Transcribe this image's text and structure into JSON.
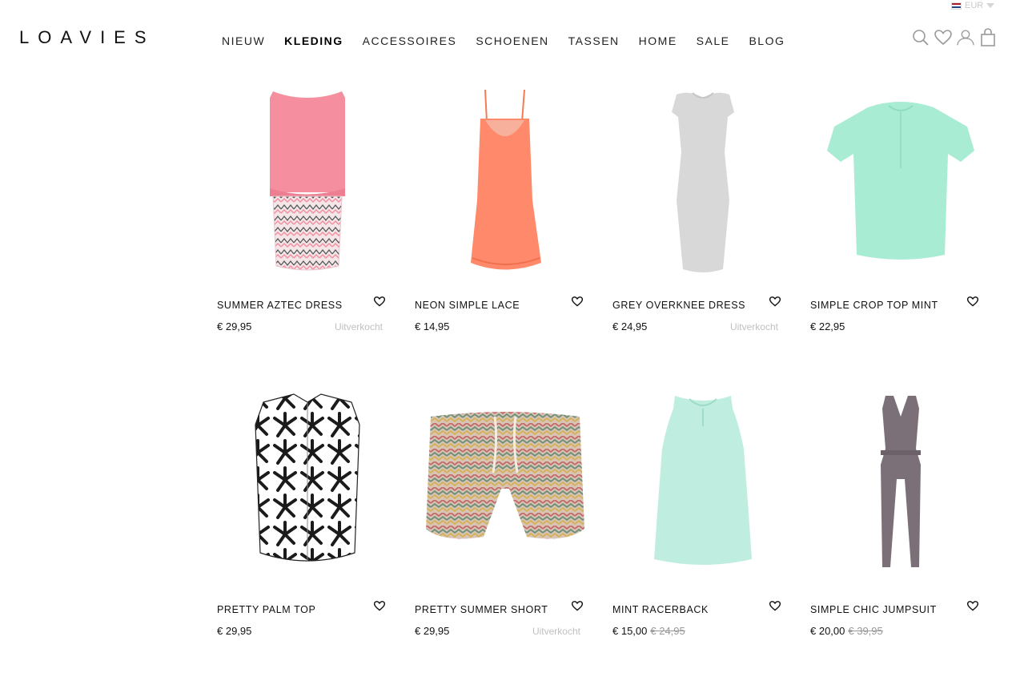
{
  "header": {
    "logo": "LOAVIES",
    "currency": "EUR",
    "nav": [
      "NIEUW",
      "KLEDING",
      "ACCESSOIRES",
      "SCHOENEN",
      "TASSEN",
      "HOME",
      "SALE",
      "BLOG"
    ],
    "active_nav": "KLEDING",
    "icons": [
      "search-icon",
      "wishlist-heart-icon",
      "account-icon",
      "cart-bag-icon"
    ]
  },
  "products": [
    {
      "name": "SUMMER AZTEC DRESS",
      "price": "€ 29,95",
      "old_price": "",
      "status": "Uitverkocht"
    },
    {
      "name": "NEON SIMPLE LACE",
      "price": "€ 14,95",
      "old_price": "",
      "status": ""
    },
    {
      "name": "GREY OVERKNEE DRESS",
      "price": "€ 24,95",
      "old_price": "",
      "status": "Uitverkocht"
    },
    {
      "name": "SIMPLE CROP TOP MINT",
      "price": "€ 22,95",
      "old_price": "",
      "status": ""
    },
    {
      "name": "PRETTY PALM TOP",
      "price": "€ 29,95",
      "old_price": "",
      "status": ""
    },
    {
      "name": "PRETTY SUMMER SHORT",
      "price": "€ 29,95",
      "old_price": "",
      "status": "Uitverkocht"
    },
    {
      "name": "MINT RACERBACK",
      "price": "€ 15,00",
      "old_price": "€ 24,95",
      "status": ""
    },
    {
      "name": "SIMPLE CHIC JUMPSUIT",
      "price": "€ 20,00",
      "old_price": "€ 39,95",
      "status": ""
    }
  ],
  "colors": {
    "pink": "#f58fa0",
    "coral": "#ff8a6b",
    "grey": "#d8d8d8",
    "mint": "#a9ecd4",
    "taupe": "#7b7078"
  }
}
